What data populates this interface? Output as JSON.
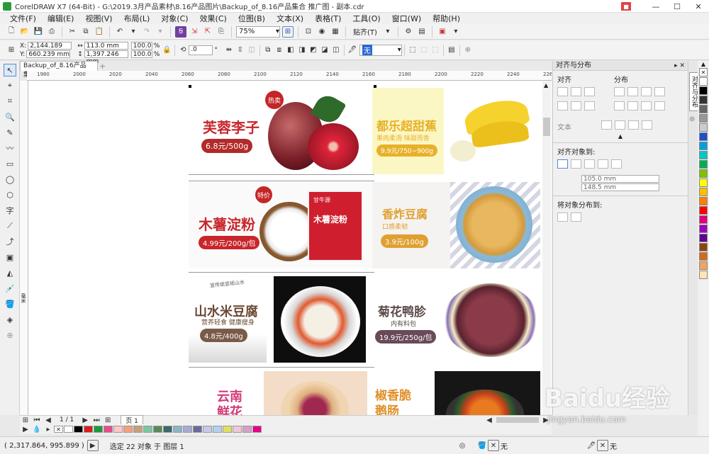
{
  "window": {
    "title": "CorelDRAW X7 (64-Bit) - G:\\2019.3月产品素材\\8.16产品图片\\Backup_of_8.16产品集合 推广图 - 副本.cdr"
  },
  "menu": [
    "文件(F)",
    "编辑(E)",
    "视图(V)",
    "布局(L)",
    "对象(C)",
    "效果(C)",
    "位图(B)",
    "文本(X)",
    "表格(T)",
    "工具(O)",
    "窗口(W)",
    "帮助(H)"
  ],
  "toolbar": {
    "zoom": "75%",
    "paste_label": "贴齐(T)"
  },
  "props": {
    "x": "2,144.189 mm",
    "y": "660.239 mm",
    "w": "113.0 mm",
    "h": "1,397.246 mm",
    "sx": "100.0",
    "sy": "100.0",
    "pct": "%",
    "angle": ".0",
    "deg": "°",
    "outline": "无"
  },
  "document": {
    "tab": "Backup_of_8.16产品集..."
  },
  "ruler": {
    "ticks": [
      "1980",
      "2000",
      "2020",
      "2040",
      "2060",
      "2080",
      "2100",
      "2120",
      "2140",
      "2160",
      "2180",
      "2200",
      "2220",
      "2240",
      "2260"
    ],
    "unit": "毫米"
  },
  "products": [
    {
      "name": "芙蓉李子",
      "price": "6.8元/500g",
      "badge": "热卖"
    },
    {
      "name": "都乐超甜蕉",
      "sub": "果肉柔滑 味甜而香",
      "price": "9.9元/750~900g"
    },
    {
      "name": "木薯淀粉",
      "price": "4.99元/200g/包",
      "badge": "特价",
      "pack_brand": "甘牛源",
      "pack_name": "木薯淀粉"
    },
    {
      "name": "香炸豆腐",
      "sub": "口感柔韧",
      "price": "3.9元/100g"
    },
    {
      "name": "山水米豆腐",
      "sub": "营养轻食 健康瘦身",
      "price": "4.8元/400g",
      "deco": "宣传纸宣纸山水"
    },
    {
      "name": "菊花鸭胗",
      "sub": "内有料包",
      "price": "19.9元/250g/包"
    },
    {
      "name": "云南鲜花饼"
    },
    {
      "name": "椒香脆鹅肠"
    }
  ],
  "pages": {
    "current": "1 / 1",
    "tab": "页 1"
  },
  "status": {
    "coords": "( 2,317.864, 995.899 )",
    "selection": "选定 22 对象 于 图层 1",
    "fill": "无",
    "outline": "无"
  },
  "docker": {
    "title": "对齐与分布",
    "align": "对齐",
    "distribute": "分布",
    "text": "文本",
    "align_to": "对齐对象到:",
    "w": "105.0 mm",
    "h": "148.5 mm",
    "distribute_to": "将对象分布到:",
    "side_tab": "对齐与分布"
  },
  "watermark": {
    "brand": "Baidu经验",
    "url": "jingyan.baidu.com"
  },
  "colors": {
    "palette_h": [
      "#ffffff",
      "#000000",
      "#d81e1e",
      "#1a9a3a",
      "#e84c8b",
      "#ffc8c8",
      "#f5a07a",
      "#c8a078",
      "#78c8a0",
      "#5a8a5a",
      "#3a6a6a",
      "#8ab4c8",
      "#a8a8d8",
      "#6a6a9a",
      "#c8c8e8",
      "#b4d2f0",
      "#e0e060",
      "#f0c8dc",
      "#d8a0c8",
      "#e8008c"
    ],
    "palette_v": [
      "#ffffff",
      "#000000",
      "#333333",
      "#666666",
      "#999999",
      "#cccccc",
      "#1e50c8",
      "#00a0e0",
      "#00c8c8",
      "#00b050",
      "#80c000",
      "#ffff00",
      "#ffc000",
      "#ff8000",
      "#ff0000",
      "#e0007a",
      "#a000c0",
      "#600090",
      "#8b4513",
      "#d2691e",
      "#f4a460",
      "#ffe4b5"
    ]
  }
}
